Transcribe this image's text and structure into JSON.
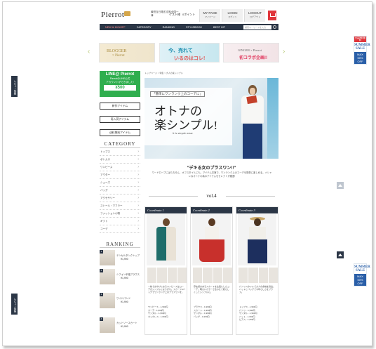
{
  "header": {
    "logo": "Pierrot",
    "info": "最短当日発送 送料全国一律",
    "links": [
      "ゲスト様",
      "0ポイント"
    ],
    "my_page": "MY PAGE",
    "my_page_sub": "マイページ",
    "login": "LOGIN",
    "login_sub": "ログイン",
    "logout": "LOGOUT",
    "logout_sub": "ログアウト"
  },
  "nav": {
    "items": [
      "NEW & 16%OFF",
      "CATEGORY",
      "RANKING",
      "STYLEBOOK",
      "BEST HIT"
    ],
    "search_placeholder": "検索キーワードを入力"
  },
  "banners": [
    {
      "title": "BLOGGER",
      "subtitle": "× Pierrot"
    },
    {
      "title": "今、売れて",
      "subtitle": "いるのはコレ!"
    },
    {
      "title": "GINGER × Pierrot",
      "subtitle": "初コラボ企画!!"
    }
  ],
  "side": {
    "left_tab_top": "レビュー特集",
    "left_tab_bottom": "レビュー特集",
    "sale_top": "全品送料無料",
    "sale_mid1": "SUMMER",
    "sale_mid2": "SALE",
    "sale_bot1": "MAX",
    "sale_bot2": "50%",
    "sale_bot3": "OFF"
  },
  "line_box": {
    "title": "LINE@ Pierrot",
    "text1": "PierrotのLINE公式",
    "text2": "アカウントができました!",
    "coupon": "¥500 "
  },
  "left_buttons": [
    "新作アイテム",
    "再入荷アイテム",
    "送料無料アイテム"
  ],
  "category": {
    "title": "CATEGORY",
    "items": [
      "トップス",
      "ボトムス",
      "ワンピース",
      "アウター",
      "シューズ",
      "バッグ",
      "アクセサリー",
      "ストール・マフラー",
      "ファッション小物",
      "ギフト",
      "コーデ"
    ]
  },
  "ranking": {
    "title": "RANKING",
    "items": [
      {
        "num": "1",
        "name": "テンセルタンクトップ",
        "price": "¥1,990"
      },
      {
        "num": "2",
        "name": "シフォン半袖ブラウス",
        "price": "¥1,990"
      },
      {
        "num": "3",
        "name": "ワイドパンツ",
        "price": "¥1,990"
      },
      {
        "num": "4",
        "name": "カットソースカート",
        "price": "¥1,990"
      }
    ]
  },
  "breadcrumb": "トップページ > 特集 > 大人の楽シンプル",
  "hero": {
    "sub": "「簡単にワンランク上のコーデに」",
    "title1": "オトナの",
    "title2": "楽シンプル!",
    "small": "It is simple wear."
  },
  "tagline": "\"デキる女のプラスワン!!\"",
  "desc": "ワードローブにはもちろん、オフスタイルにも。アイテム次第で、ワンランク上のコーデを簡単に楽しめる。メシャレなオトナの為のアイテムをセレクトが厳選!",
  "vol": "vol.4",
  "coordinates": [
    {
      "head": "Coordinate.1",
      "text": "一枚でおやけになるワンピースはコーデがシンプルになりがち。スカーフ&バッグでワンランク上のプラスワンを。",
      "items": [
        "ワンピース…1,990円",
        "カーデ…1,990円",
        "サンダル…1,990円",
        "ネックレス…1,990円"
      ]
    },
    {
      "head": "Coordinate.2",
      "text": "存在感のあるスカートを主役にしたコーデ。明るいカラーで合わせて夏らしくしてシンプルに。",
      "items": [
        "ブラウス…1,990円",
        "スカート…1,990円",
        "サンダル…1,990円",
        "バッグ…1,990円"
      ]
    },
    {
      "head": "Coordinate.3",
      "text": "パンツスタイルで大人の余裕を演出。ハットとバッグで今年らしさをプラス。",
      "items": [
        "トップス…1,990円",
        "パンツ…1,990円",
        "サンダル…1,990円",
        "ハット…1,990円",
        "ピアス…1,990円"
      ]
    }
  ],
  "colors": {
    "navy": "#2b3646",
    "red": "#e0353b",
    "line_green": "#2fae4e",
    "sale_blue": "#2a5fa8"
  }
}
